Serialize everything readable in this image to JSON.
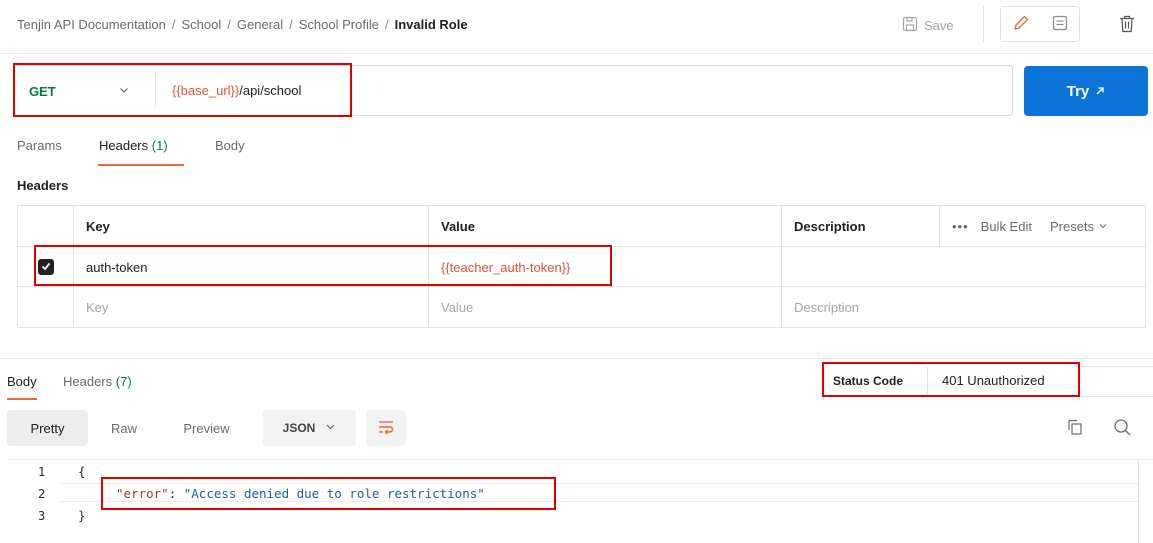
{
  "breadcrumb": {
    "items": [
      "Tenjin API Documentation",
      "School",
      "General",
      "School Profile"
    ],
    "separator": "/",
    "current": "Invalid Role"
  },
  "toolbar": {
    "save_label": "Save",
    "edit_icon": "pencil-icon",
    "comment_icon": "comment-icon",
    "delete_icon": "trash-icon"
  },
  "request": {
    "method": "GET",
    "url_variable": "{{base_url}}",
    "url_path": "/api/school",
    "try_label": "Try",
    "try_icon": "external-arrow-icon"
  },
  "request_tabs": [
    {
      "label": "Params"
    },
    {
      "label": "Headers",
      "count": "(1)"
    },
    {
      "label": "Body"
    }
  ],
  "headers_section": {
    "title": "Headers",
    "columns": {
      "key": "Key",
      "value": "Value",
      "description": "Description"
    },
    "actions": {
      "more": "•••",
      "bulk_edit": "Bulk Edit",
      "presets": "Presets"
    },
    "rows": [
      {
        "checked": true,
        "key": "auth-token",
        "value": "{{teacher_auth-token}}",
        "description": ""
      }
    ],
    "placeholder": {
      "key": "Key",
      "value": "Value",
      "description": "Description"
    }
  },
  "response": {
    "tabs": [
      {
        "label": "Body"
      },
      {
        "label": "Headers",
        "count": "(7)"
      }
    ],
    "status_label": "Status Code",
    "status_value": "401 Unauthorized",
    "format_tabs": [
      "Pretty",
      "Raw",
      "Preview"
    ],
    "format_select": "JSON",
    "code_lines": [
      {
        "num": "1",
        "text": "{"
      },
      {
        "num": "2",
        "key": "\"error\"",
        "colon": ": ",
        "value": "\"Access denied due to role restrictions\""
      },
      {
        "num": "3",
        "text": "}"
      }
    ]
  },
  "colors": {
    "accent": "#e8683c",
    "primary_button": "#0c74d9",
    "method_get": "#0c7a3f",
    "variable": "#e0553a",
    "highlight": "#e00000"
  }
}
